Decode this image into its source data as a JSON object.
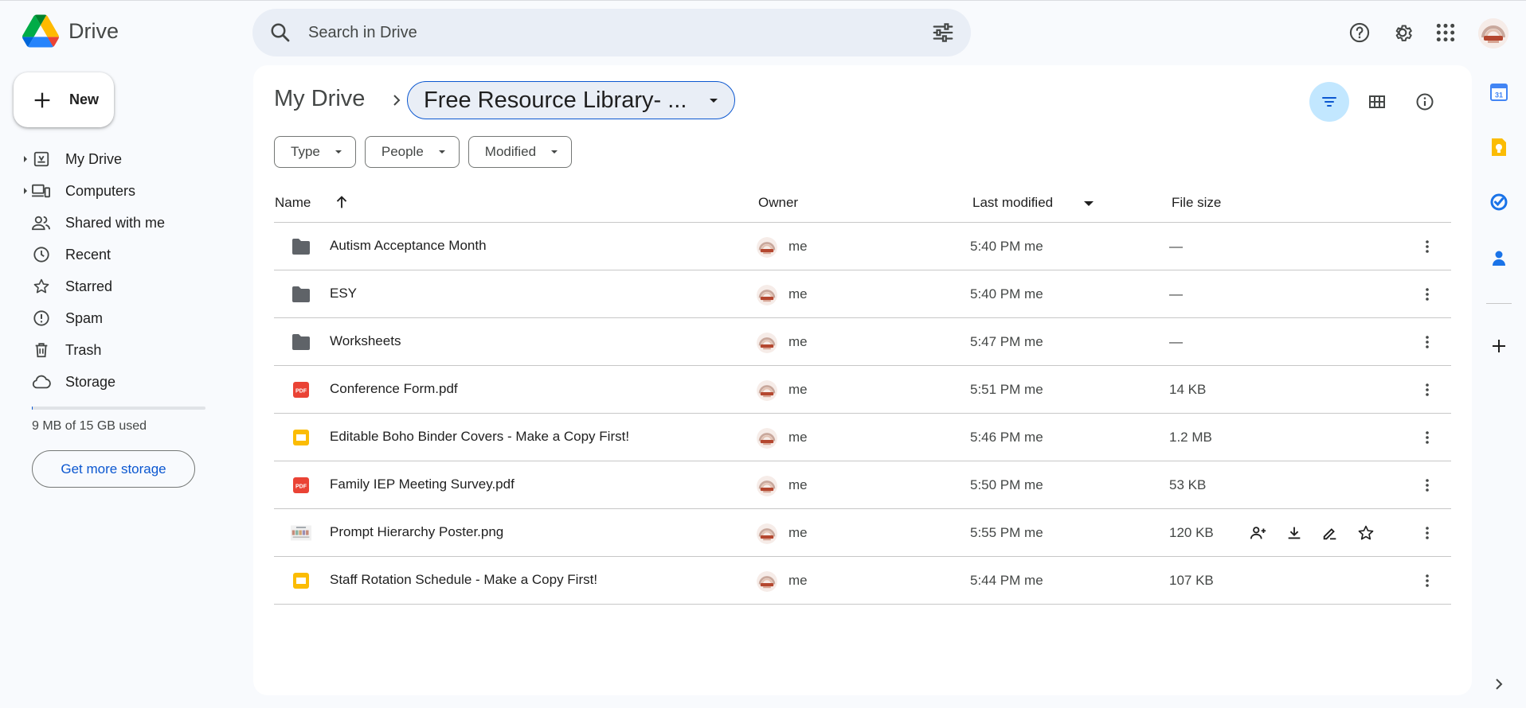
{
  "app": {
    "name": "Drive"
  },
  "search": {
    "placeholder": "Search in Drive"
  },
  "new_button": {
    "label": "New"
  },
  "nav": {
    "items": [
      {
        "label": "My Drive",
        "icon": "my-drive-icon",
        "expandable": true
      },
      {
        "label": "Computers",
        "icon": "computers-icon",
        "expandable": true
      },
      {
        "label": "Shared with me",
        "icon": "shared-icon",
        "expandable": false
      },
      {
        "label": "Recent",
        "icon": "clock-icon",
        "expandable": false
      },
      {
        "label": "Starred",
        "icon": "star-icon",
        "expandable": false
      },
      {
        "label": "Spam",
        "icon": "spam-icon",
        "expandable": false
      },
      {
        "label": "Trash",
        "icon": "trash-icon",
        "expandable": false
      },
      {
        "label": "Storage",
        "icon": "cloud-icon",
        "expandable": false
      }
    ]
  },
  "storage": {
    "used_text": "9 MB of 15 GB used",
    "used_fraction": 0.0006,
    "cta": "Get more storage"
  },
  "breadcrumb": {
    "root": "My Drive",
    "current": "Free Resource Library- ..."
  },
  "filters": [
    {
      "label": "Type"
    },
    {
      "label": "People"
    },
    {
      "label": "Modified"
    }
  ],
  "table": {
    "columns": {
      "name": "Name",
      "owner": "Owner",
      "modified": "Last modified",
      "size": "File size"
    },
    "rows": [
      {
        "name": "Autism Acceptance Month",
        "type": "folder",
        "owner": "me",
        "modified": "5:40 PM me",
        "size": "—"
      },
      {
        "name": "ESY",
        "type": "folder",
        "owner": "me",
        "modified": "5:40 PM me",
        "size": "—"
      },
      {
        "name": "Worksheets",
        "type": "folder",
        "owner": "me",
        "modified": "5:47 PM me",
        "size": "—"
      },
      {
        "name": "Conference Form.pdf",
        "type": "pdf",
        "owner": "me",
        "modified": "5:51 PM me",
        "size": "14 KB"
      },
      {
        "name": "Editable Boho Binder Covers - Make a Copy First!",
        "type": "slides",
        "owner": "me",
        "modified": "5:46 PM me",
        "size": "1.2 MB"
      },
      {
        "name": "Family IEP Meeting Survey.pdf",
        "type": "pdf",
        "owner": "me",
        "modified": "5:50 PM me",
        "size": "53 KB"
      },
      {
        "name": "Prompt Hierarchy Poster.png",
        "type": "image",
        "owner": "me",
        "modified": "5:55 PM me",
        "size": "120 KB",
        "hovered": true
      },
      {
        "name": "Staff Rotation Schedule - Make a Copy First!",
        "type": "slides",
        "owner": "me",
        "modified": "5:44 PM me",
        "size": "107 KB"
      }
    ]
  },
  "colors": {
    "accent": "#0b57d0",
    "filter_active": "#c2e7ff",
    "folder": "#5f6368",
    "pdf": "#ea4335",
    "slides": "#fbbc04"
  }
}
